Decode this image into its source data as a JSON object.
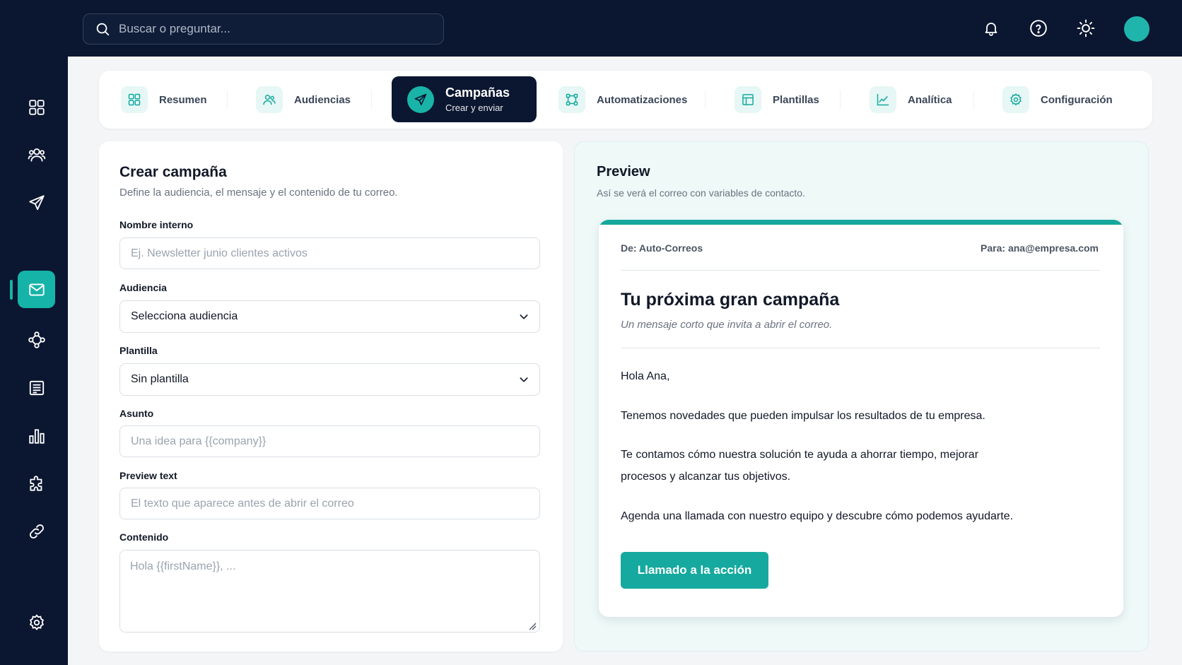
{
  "topbar": {
    "search_placeholder": "Buscar o preguntar...",
    "icons": [
      "bell-icon",
      "help-icon",
      "sun-icon"
    ],
    "avatar_color": "#1fb5ad"
  },
  "sidebar": {
    "items": [
      "grid-icon",
      "users-icon",
      "send-icon",
      "mail-icon",
      "workflow-icon",
      "template-icon",
      "chart-icon",
      "puzzle-icon",
      "link-icon"
    ],
    "active_item": "mail-icon",
    "bottom_item": "gear-icon"
  },
  "tabs": [
    {
      "label": "Resumen",
      "icon": "grid-icon"
    },
    {
      "label": "Audiencias",
      "icon": "users-icon"
    },
    {
      "label": "Campañas",
      "sublabel": "Crear y enviar",
      "icon": "send-icon",
      "active": true
    },
    {
      "label": "Automatizaciones",
      "icon": "workflow-icon"
    },
    {
      "label": "Plantillas",
      "icon": "template-icon"
    },
    {
      "label": "Analítica",
      "icon": "chart-icon"
    },
    {
      "label": "Configuración",
      "icon": "gear-icon"
    }
  ],
  "form": {
    "title": "Crear campaña",
    "subtitle": "Define la audiencia, el mensaje y el contenido de tu correo.",
    "name_label": "Nombre interno",
    "name_placeholder": "Ej. Newsletter junio clientes activos",
    "audience_label": "Audiencia",
    "audience_value": "Selecciona audiencia",
    "template_label": "Plantilla",
    "template_value": "Sin plantilla",
    "subject_label": "Asunto",
    "subject_placeholder": "Una idea para {{company}}",
    "preview_label": "Preview text",
    "preview_placeholder": "El texto que aparece antes de abrir el correo",
    "content_label": "Contenido",
    "content_placeholder": "Hola {{firstName}}, ..."
  },
  "preview": {
    "title": "Preview",
    "subtitle": "Así se verá el correo con variables de contacto.",
    "from": "De: Auto-Correos",
    "to": "Para: ana@empresa.com",
    "email_title": "Tu próxima gran campaña",
    "email_subtitle": "Un mensaje corto que invita a abrir el correo.",
    "greeting": "Hola Ana,",
    "p1": "Tenemos novedades que pueden impulsar los resultados de tu empresa.",
    "p2": "Te contamos cómo nuestra solución te ayuda a ahorrar tiempo, mejorar procesos y alcanzar tus objetivos.",
    "p3": "Agenda una llamada con nuestro equipo y descubre cómo podemos ayudarte.",
    "cta": "Llamado a la acción"
  },
  "colors": {
    "accent": "#16b3a8",
    "navy": "#0b1630"
  }
}
